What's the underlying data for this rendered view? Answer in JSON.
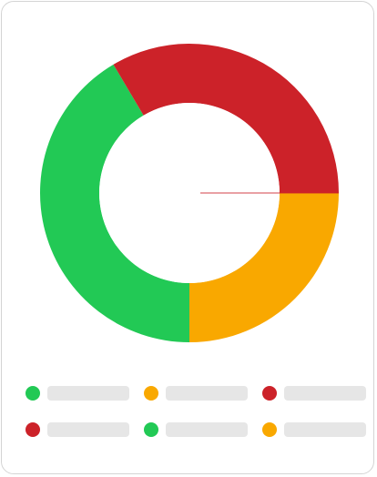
{
  "chart_data": {
    "type": "donut",
    "title": "",
    "series": [
      {
        "color": "#f9a800",
        "value": 25.0
      },
      {
        "color": "#22c955",
        "value": 41.5
      },
      {
        "color": "#cc2229",
        "value": 33.5
      }
    ],
    "sliver": {
      "color": "#cc2229",
      "value": 0.1
    },
    "legend": {
      "placement": "bottom",
      "entries": [
        {
          "color": "#22c955",
          "label": ""
        },
        {
          "color": "#f9a800",
          "label": ""
        },
        {
          "color": "#cc2229",
          "label": ""
        },
        {
          "color": "#cc2229",
          "label": ""
        },
        {
          "color": "#22c955",
          "label": ""
        },
        {
          "color": "#f9a800",
          "label": ""
        }
      ]
    }
  }
}
